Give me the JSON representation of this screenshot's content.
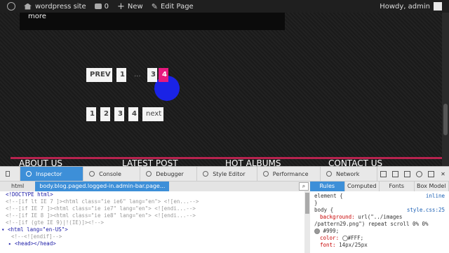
{
  "admin_bar": {
    "site_name": "wordpress site",
    "comments_count": "0",
    "new_label": "New",
    "edit_label": "Edit Page",
    "greeting": "Howdy, admin"
  },
  "post": {
    "more_text": "more"
  },
  "pagination_top": {
    "items": [
      "PREV",
      "1",
      "...",
      "3",
      "4"
    ],
    "current": "4"
  },
  "pagination_bottom": {
    "items": [
      "1",
      "2",
      "3",
      "4",
      "next"
    ]
  },
  "footer": {
    "headings": [
      "ABOUT US",
      "LATEST POST",
      "HOT ALBUMS",
      "CONTACT US"
    ]
  },
  "devtools": {
    "tabs": [
      "Inspector",
      "Console",
      "Debugger",
      "Style Editor",
      "Performance",
      "Network"
    ],
    "active_tab": "Inspector",
    "breadcrumbs": [
      "html",
      "body.blog.paged.logged-in.admin-bar.page..."
    ],
    "markup_lines": [
      "<!DOCTYPE html>",
      "<!--[if lt IE 7 ]><html class=\"ie ie6\" lang=\"en\"> <![en...-->",
      "<!--[if IE 7 ]><html class=\"ie ie7\" lang=\"en\"> <![endi...-->",
      "<!--[if IE 8 ]><html class=\"ie ie8\" lang=\"en\"> <![endi...-->",
      "<!--[if (gte IE 9)|!(IE)]><!-->",
      "<html lang=\"en-US\">",
      "<!--<![endif]-->",
      "<head></head>"
    ],
    "rules_tabs": [
      "Rules",
      "Computed",
      "Fonts",
      "Box Model"
    ],
    "active_rules_tab": "Rules",
    "rules": {
      "element_selector": "element {",
      "element_source": "inline",
      "element_close": "}",
      "body_selector": "body {",
      "body_source": "style.css:25",
      "background_prop": "background:",
      "background_val": "url(\"../images",
      "background_val2": "/pattern29.png\") repeat scroll 0% 0%",
      "background_val3": "#999;",
      "color_prop": "color:",
      "color_val": "#FFF;",
      "font_prop": "font:",
      "font_val": "14px/25px"
    }
  },
  "colors": {
    "current_page_bg": "#e6197e",
    "highlight_circle": "#1a23e6",
    "footer_line": "#b8234f",
    "devtools_accent": "#3d8fd8"
  }
}
